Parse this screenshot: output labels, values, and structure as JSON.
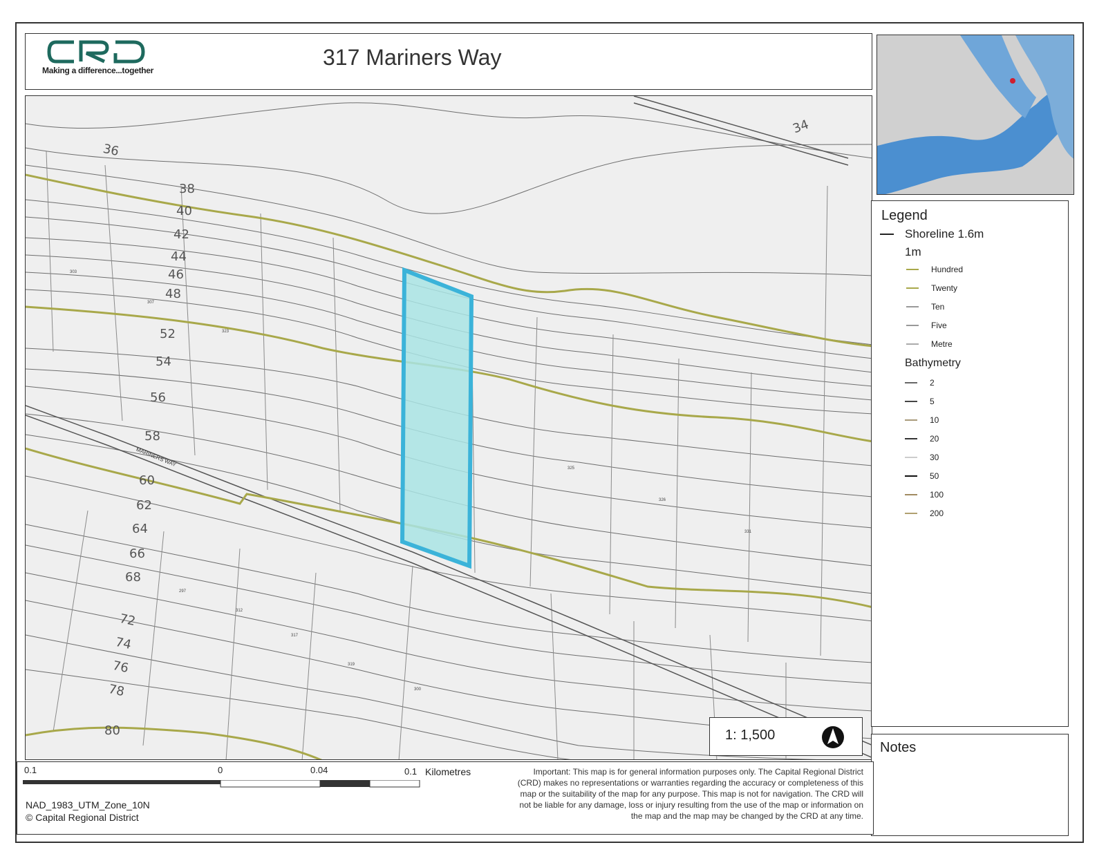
{
  "header": {
    "logo_text": "CRD",
    "tagline": "Making a difference...together",
    "title": "317 Mariners Way"
  },
  "map": {
    "road_label": "MARINERS WAY",
    "contour_labels": [
      "36",
      "38",
      "40",
      "42",
      "44",
      "46",
      "48",
      "52",
      "54",
      "56",
      "58",
      "60",
      "62",
      "64",
      "66",
      "68",
      "72",
      "74",
      "76",
      "78",
      "80",
      "34"
    ],
    "parcel_numbers": [
      "303",
      "307",
      "323",
      "325",
      "326",
      "331",
      "297",
      "312",
      "317",
      "319",
      "300"
    ],
    "highlight_color": "#3bb3d9",
    "highlight_fill": "#a9e4e4",
    "contour_color": "#a8a84a",
    "line_color": "#555555"
  },
  "legend": {
    "title": "Legend",
    "shoreline": "Shoreline 1.6m",
    "one_m": "1m",
    "contours": [
      "Hundred",
      "Twenty",
      "Ten",
      "Five",
      "Metre"
    ],
    "bathymetry_title": "Bathymetry",
    "bathymetry": [
      "2",
      "5",
      "10",
      "20",
      "30",
      "50",
      "100",
      "200"
    ]
  },
  "notes": {
    "title": "Notes"
  },
  "scale": {
    "ratio": "1: 1,500",
    "left_label": "0.1",
    "zero_label": "0",
    "mid_label": "0.04",
    "right_label": "0.1",
    "unit": "Kilometres"
  },
  "footer": {
    "crs": "NAD_1983_UTM_Zone_10N",
    "copyright": "© Capital Regional District",
    "disclaimer": "Important: This map is for general information purposes only. The Capital Regional District (CRD) makes no representations or warranties regarding the accuracy or completeness of this map or the suitability of the map for any purpose. This map is not for navigation. The CRD will not be liable for any damage, loss or injury resulting from the use of the map or information on the map and the map may be changed by the CRD at any time."
  }
}
